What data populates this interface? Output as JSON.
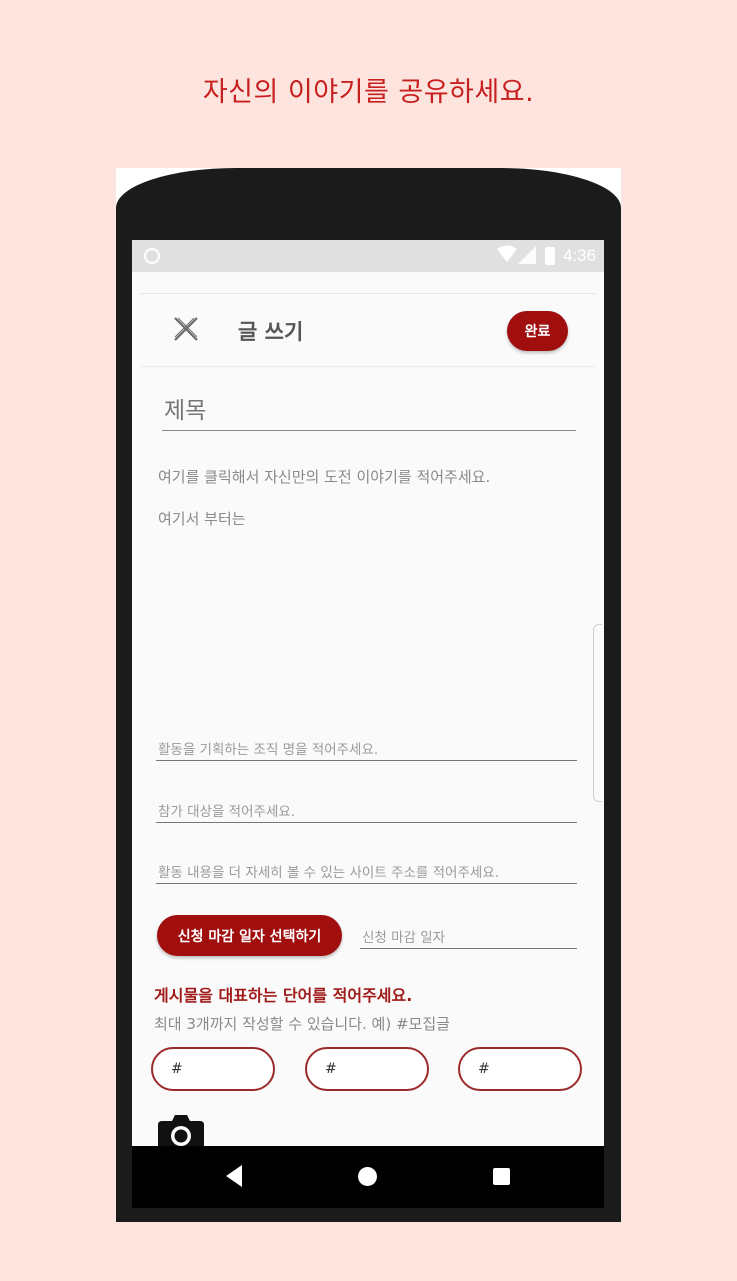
{
  "caption": "자신의 이야기를 공유하세요.",
  "status_bar": {
    "time": "4:36"
  },
  "toolbar": {
    "title": "글 쓰기",
    "done_label": "완료"
  },
  "post": {
    "title_placeholder": "제목",
    "body_lines": [
      "여기를 클릭해서 자신만의 도전 이야기를 적어주세요.",
      "여기서 부터는"
    ]
  },
  "fields": {
    "organization_placeholder": "활동을 기획하는 조직 명을 적어주세요.",
    "target_placeholder": "참가 대상을 적어주세요.",
    "website_placeholder": "활동 내용을 더 자세히 볼 수 있는 사이트 주소를 적어주세요.",
    "deadline_button": "신청 마감 일자 선택하기",
    "deadline_placeholder": "신청 마감 일자"
  },
  "tags": {
    "heading": "게시물을 대표하는 단어를 적어주세요.",
    "subheading": "최대 3개까지 작성할 수 있습니다. 예) #모집글",
    "inputs": [
      "#",
      "#",
      "#"
    ]
  },
  "colors": {
    "accent": "#a00e0e",
    "background": "#fde4df",
    "caption": "#c8201f"
  },
  "icons": [
    "close-icon",
    "camera-icon",
    "nav-back-icon",
    "nav-home-icon",
    "nav-recent-icon",
    "wifi-icon",
    "signal-icon",
    "battery-icon"
  ]
}
